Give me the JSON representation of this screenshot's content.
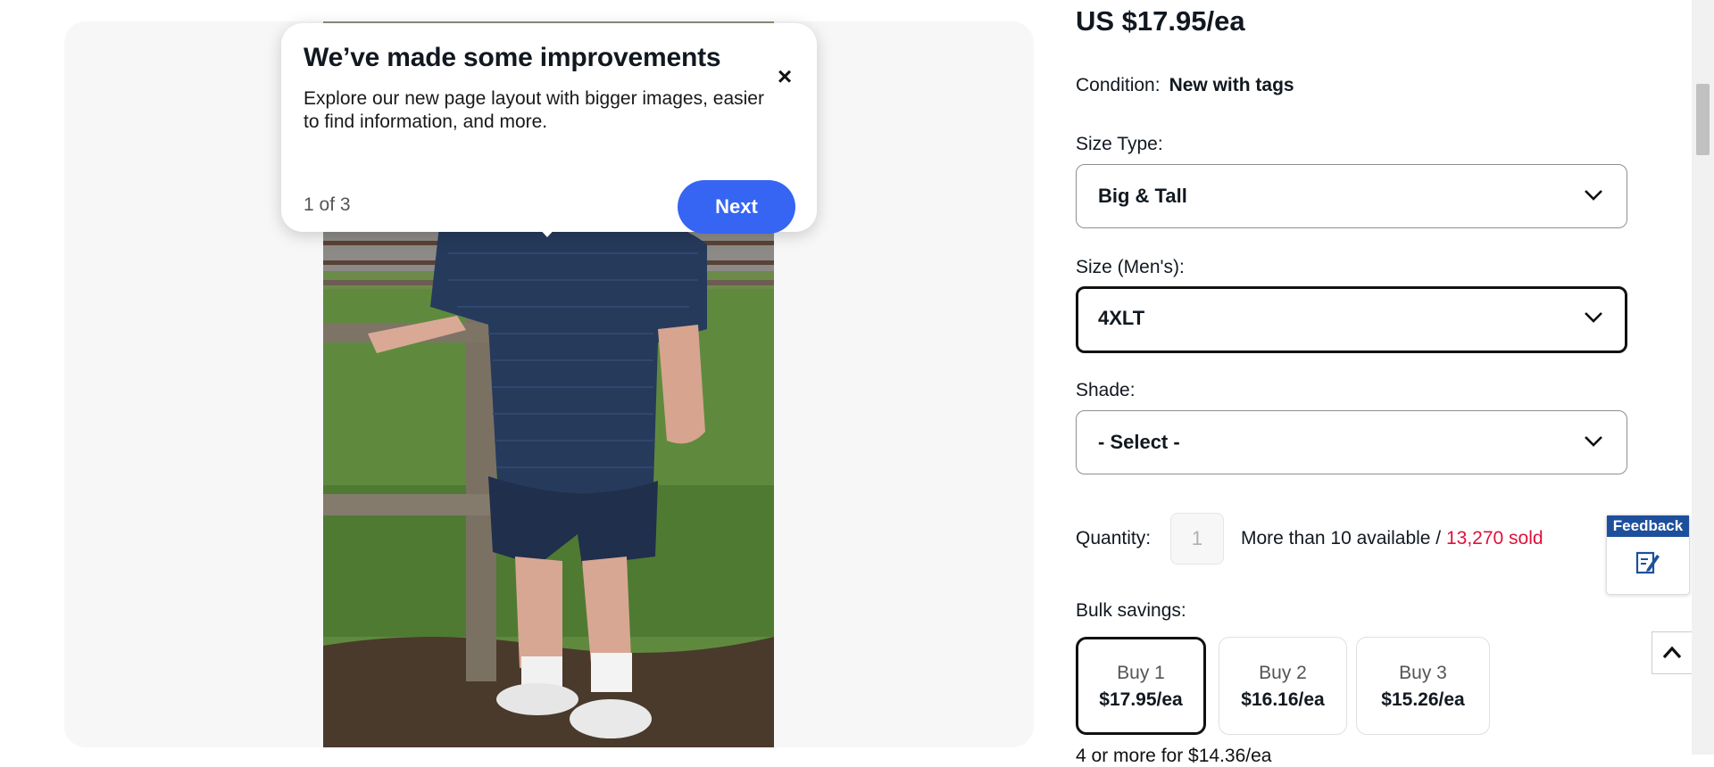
{
  "popover": {
    "title": "We’ve made some improvements",
    "body": "Explore our new page layout with bigger images, easier to find information, and more.",
    "step": "1 of 3",
    "next_label": "Next",
    "close_icon": "×"
  },
  "item": {
    "price": "US $17.95/ea",
    "condition_label": "Condition:",
    "condition_value": "New with tags"
  },
  "variations": {
    "size_type": {
      "label": "Size Type:",
      "value": "Big & Tall"
    },
    "size": {
      "label": "Size (Men's):",
      "value": "4XLT"
    },
    "shade": {
      "label": "Shade:",
      "value": "- Select -"
    }
  },
  "quantity": {
    "label": "Quantity:",
    "value": "1",
    "availability": "More than 10 available / ",
    "sold": "13,270 sold"
  },
  "bulk": {
    "label": "Bulk savings:",
    "options": [
      {
        "qty": "Buy 1",
        "price": "$17.95/ea"
      },
      {
        "qty": "Buy 2",
        "price": "$16.16/ea"
      },
      {
        "qty": "Buy 3",
        "price": "$15.26/ea"
      }
    ],
    "selected_index": 0,
    "partial_line": "4 or more for $14.36/ea"
  },
  "widgets": {
    "feedback_label": "Feedback"
  },
  "colors": {
    "primary_button": "#3665f3",
    "sold_count": "#e0103a",
    "feedback_header": "#1d4f9c"
  }
}
